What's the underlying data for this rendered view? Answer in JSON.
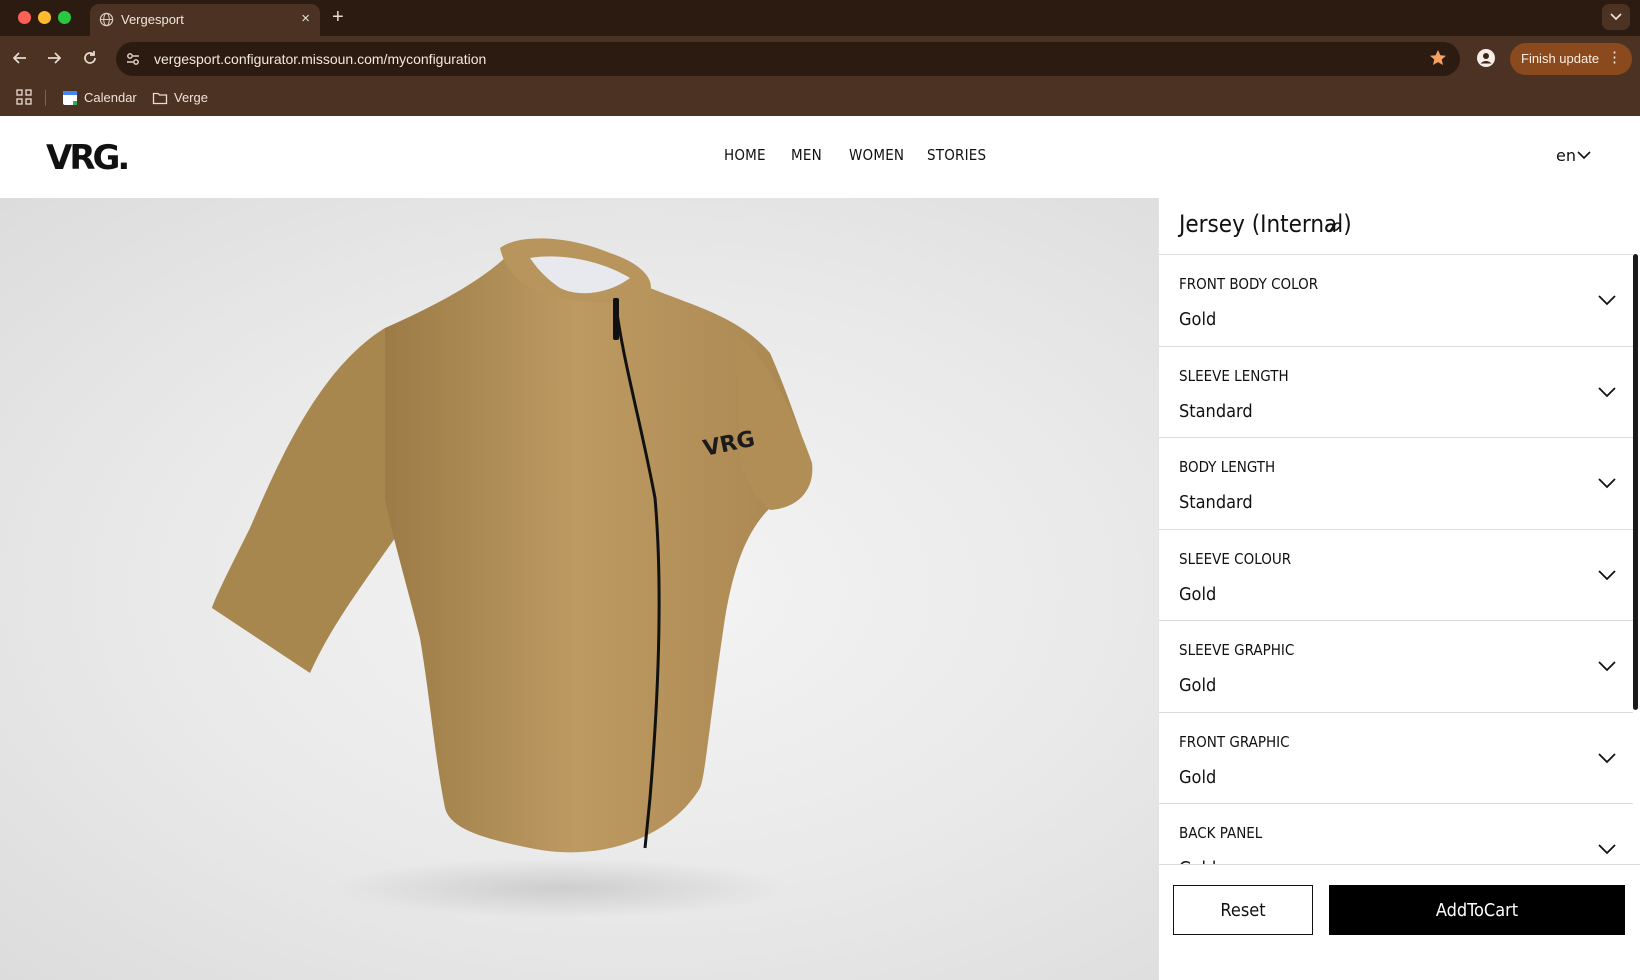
{
  "browser": {
    "tab_title": "Vergesport",
    "tab_close": "×",
    "new_tab": "+",
    "url": "vergesport.configurator.missoun.com/myconfiguration",
    "finish_update": "Finish update",
    "menu_dots": "⋮",
    "bookmarks": [
      {
        "label": "Calendar",
        "icon": "calendar-icon"
      },
      {
        "label": "Verge",
        "icon": "folder-icon"
      }
    ]
  },
  "site": {
    "logo": "VRG.",
    "nav": [
      "HOME",
      "MEN",
      "WOMEN",
      "STORIES"
    ],
    "language": "en"
  },
  "product": {
    "title": "Jersey (Internal)",
    "color": "#b8955c",
    "logo_text": "VRG"
  },
  "options": [
    {
      "label": "FRONT BODY COLOR",
      "value": "Gold"
    },
    {
      "label": "SLEEVE LENGTH",
      "value": "Standard"
    },
    {
      "label": "BODY LENGTH",
      "value": "Standard"
    },
    {
      "label": "SLEEVE COLOUR",
      "value": "Gold"
    },
    {
      "label": "SLEEVE GRAPHIC",
      "value": "Gold"
    },
    {
      "label": "FRONT GRAPHIC",
      "value": "Gold"
    },
    {
      "label": "BACK PANEL",
      "value": "Gold"
    }
  ],
  "actions": {
    "reset": "Reset",
    "add_to_cart": "AddToCart"
  },
  "colors": {
    "chrome_dark": "#2b1b10",
    "chrome": "#4b3223",
    "accent_button": "#8a4a1e",
    "star": "#f4a261"
  }
}
